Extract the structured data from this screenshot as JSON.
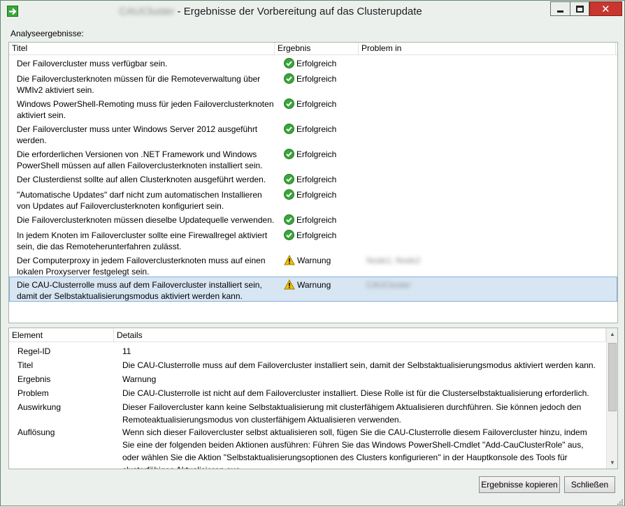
{
  "window": {
    "title_blurred": "CAUCluster",
    "title": " - Ergebnisse der Vorbereitung auf das Clusterupdate",
    "accent_color": "#5e8b6e"
  },
  "analysis_label": "Analyseergebnisse:",
  "upper_columns": [
    "Titel",
    "Ergebnis",
    "Problem in"
  ],
  "results": [
    {
      "title": "Der Failovercluster muss verfügbar sein.",
      "result": "Erfolgreich",
      "icon": "success-icon",
      "problem": ""
    },
    {
      "title": "Die Failoverclusterknoten müssen für die Remoteverwaltung über WMIv2 aktiviert sein.",
      "result": "Erfolgreich",
      "icon": "success-icon",
      "problem": ""
    },
    {
      "title": "Windows PowerShell-Remoting muss für jeden Failoverclusterknoten aktiviert sein.",
      "result": "Erfolgreich",
      "icon": "success-icon",
      "problem": ""
    },
    {
      "title": "Der Failovercluster muss unter Windows Server 2012 ausgeführt werden.",
      "result": "Erfolgreich",
      "icon": "success-icon",
      "problem": ""
    },
    {
      "title": "Die erforderlichen Versionen von .NET Framework und Windows PowerShell müssen auf allen Failoverclusterknoten installiert sein.",
      "result": "Erfolgreich",
      "icon": "success-icon",
      "problem": ""
    },
    {
      "title": "Der Clusterdienst sollte auf allen Clusterknoten ausgeführt werden.",
      "result": "Erfolgreich",
      "icon": "success-icon",
      "problem": ""
    },
    {
      "title": "\"Automatische Updates\" darf nicht zum automatischen Installieren von Updates auf Failoverclusterknoten konfiguriert sein.",
      "result": "Erfolgreich",
      "icon": "success-icon",
      "problem": ""
    },
    {
      "title": "Die Failoverclusterknoten müssen dieselbe Updatequelle verwenden.",
      "result": "Erfolgreich",
      "icon": "success-icon",
      "problem": ""
    },
    {
      "title": "In jedem Knoten im Failovercluster sollte eine Firewallregel aktiviert sein, die das Remoteherunterfahren zulässt.",
      "result": "Erfolgreich",
      "icon": "success-icon",
      "problem": ""
    },
    {
      "title": "Der Computerproxy in jedem Failoverclusterknoten muss auf einen lokalen Proxyserver festgelegt sein.",
      "result": "Warnung",
      "icon": "warning-icon",
      "problem": "Node1; Node2"
    },
    {
      "title": "Die CAU-Clusterrolle muss auf dem Failovercluster installiert sein, damit der Selbstaktualisierungsmodus aktiviert werden kann.",
      "result": "Warnung",
      "icon": "warning-icon",
      "problem": "CAUCluster"
    }
  ],
  "lower_columns": [
    "Element",
    "Details"
  ],
  "details": [
    {
      "key": "Regel-ID",
      "value": "11"
    },
    {
      "key": "Titel",
      "value": "Die CAU-Clusterrolle muss auf dem Failovercluster installiert sein, damit der Selbstaktualisierungsmodus aktiviert werden kann."
    },
    {
      "key": "Ergebnis",
      "value": "Warnung"
    },
    {
      "key": "Problem",
      "value": "Die CAU-Clusterrolle ist nicht auf dem Failovercluster installiert. Diese Rolle ist für die Clusterselbstaktualisierung erforderlich."
    },
    {
      "key": "Auswirkung",
      "value": "Dieser Failovercluster kann keine Selbstaktualisierung mit clusterfähigem Aktualisieren durchführen. Sie können jedoch den Remoteaktualisierungsmodus von clusterfähigem Aktualisieren verwenden."
    },
    {
      "key": "Auflösung",
      "value": "Wenn sich dieser Failovercluster selbst aktualisieren soll, fügen Sie die CAU-Clusterrolle diesem Failovercluster hinzu, indem Sie eine der folgenden beiden Aktionen ausführen: Führen Sie das Windows PowerShell-Cmdlet \"Add-CauClusterRole\" aus, oder wählen Sie die Aktion \"Selbstaktualisierungsoptionen des Clusters konfigurieren\" in der Hauptkonsole des Tools für clusterfähiges Aktualisieren aus."
    }
  ],
  "buttons": {
    "copy": "Ergebnisse kopieren",
    "close": "Schließen"
  }
}
